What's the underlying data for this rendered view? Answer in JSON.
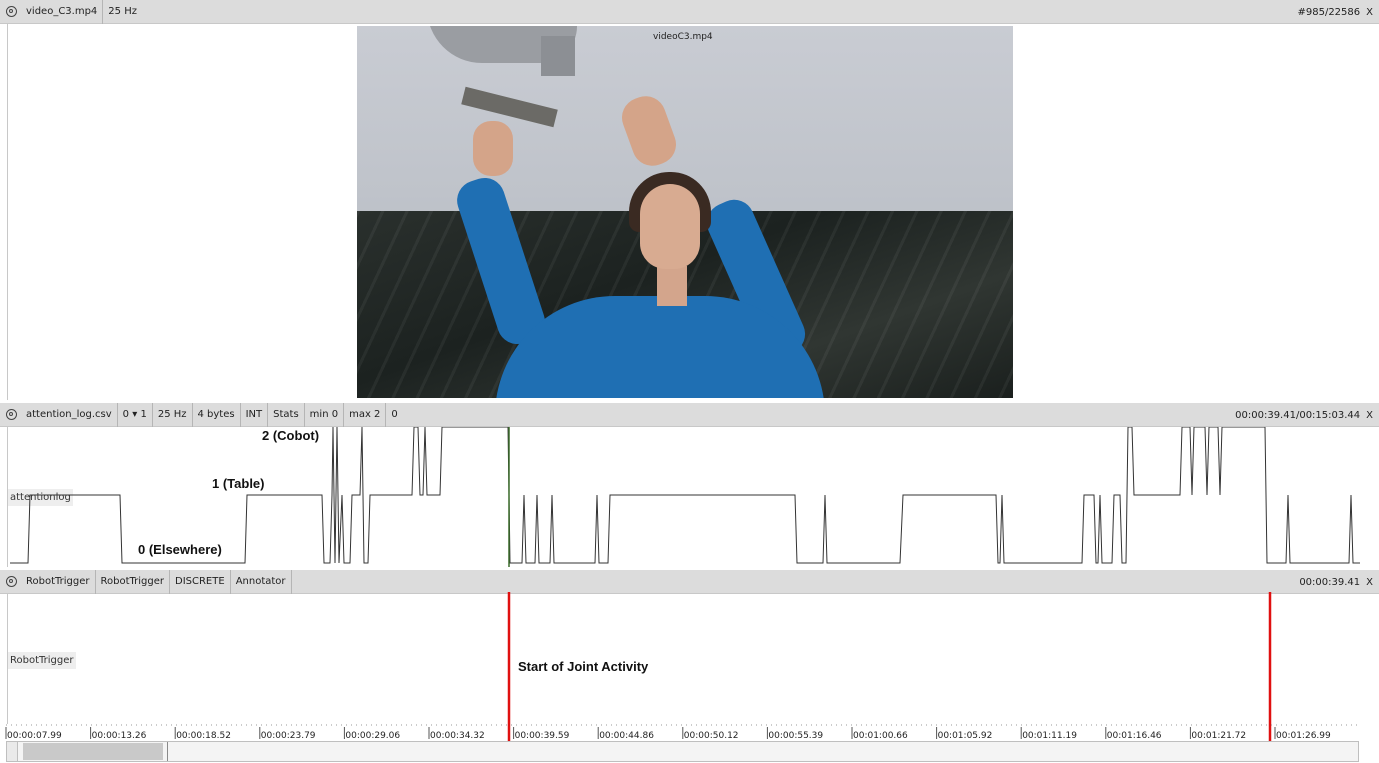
{
  "video_panel": {
    "file": "video_C3.mp4",
    "rate": "25 Hz",
    "frame_counter": "#985/22586",
    "close": "X",
    "overlay_label": "videoC3.mp4"
  },
  "attention_panel": {
    "file": "attention_log.csv",
    "dim": "0",
    "dropdown_arrow": "▾",
    "dim2": "1",
    "rate": "25 Hz",
    "bytes": "4 bytes",
    "type": "INT",
    "stats": "Stats",
    "min": "min 0",
    "max": "max 2",
    "value": "0",
    "time": "00:00:39.41/00:15:03.44",
    "close": "X",
    "track_label": "attentionlog",
    "annotations": {
      "level2": "2 (Cobot)",
      "level1": "1 (Table)",
      "level0": "0 (Elsewhere)"
    }
  },
  "trigger_panel": {
    "name1": "RobotTrigger",
    "name2": "RobotTrigger",
    "mode": "DISCRETE",
    "annotator": "Annotator",
    "time": "00:00:39.41",
    "close": "X",
    "track_label": "RobotTrigger",
    "annotation": "Start of Joint Activity"
  },
  "timeline": {
    "ticks": [
      "00:00:07.99",
      "00:00:13.26",
      "00:00:18.52",
      "00:00:23.79",
      "00:00:29.06",
      "00:00:34.32",
      "00:00:39.59",
      "00:00:44.86",
      "00:00:50.12",
      "00:00:55.39",
      "00:01:00.66",
      "00:01:05.92",
      "00:01:11.19",
      "00:01:16.46",
      "00:01:21.72",
      "00:01:26.99"
    ]
  },
  "colors": {
    "header_bg": "#dcdcdc",
    "signal": "#333333",
    "cursor": "#3a6b2a",
    "trigger": "#e01010"
  }
}
